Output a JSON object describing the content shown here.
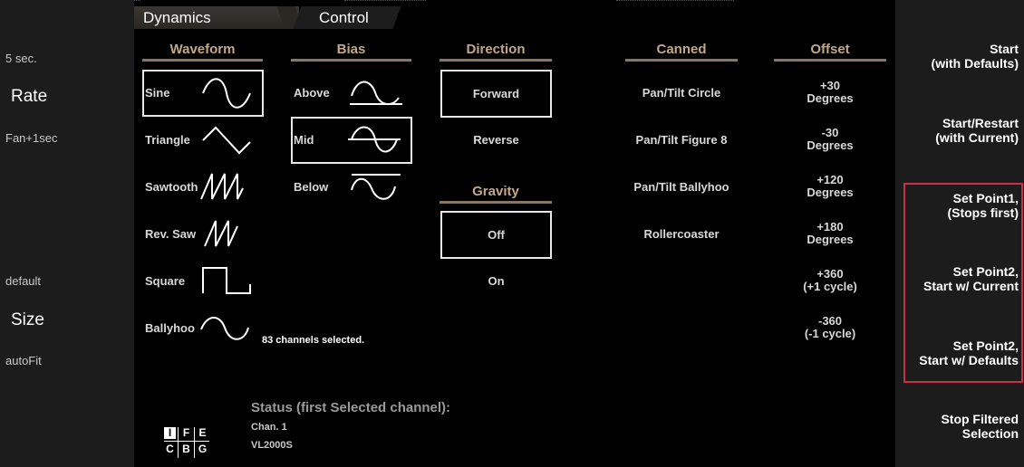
{
  "left": {
    "fade_time": "5 sec.",
    "rate_label": "Rate",
    "rate_value": "Fan+1sec",
    "size_value": "default",
    "size_label": "Size",
    "size_mode": "autoFit"
  },
  "tabs": {
    "dynamics": "Dynamics",
    "control": "Control"
  },
  "waveform": {
    "header": "Waveform",
    "items": [
      "Sine",
      "Triangle",
      "Sawtooth",
      "Rev. Saw",
      "Square",
      "Ballyhoo"
    ]
  },
  "bias": {
    "header": "Bias",
    "items": [
      "Above",
      "Mid",
      "Below"
    ]
  },
  "direction": {
    "header": "Direction",
    "items": [
      "Forward",
      "Reverse"
    ]
  },
  "gravity": {
    "header": "Gravity",
    "items": [
      "Off",
      "On"
    ]
  },
  "canned": {
    "header": "Canned",
    "items": [
      "Pan/Tilt Circle",
      "Pan/Tilt Figure 8",
      "Pan/Tilt Ballyhoo",
      "Rollercoaster"
    ]
  },
  "offset": {
    "header": "Offset",
    "items": [
      {
        "l1": "+30",
        "l2": "Degrees"
      },
      {
        "l1": "-30",
        "l2": "Degrees"
      },
      {
        "l1": "+120",
        "l2": "Degrees"
      },
      {
        "l1": "+180",
        "l2": "Degrees"
      },
      {
        "l1": "+360",
        "l2": "(+1 cycle)"
      },
      {
        "l1": "-360",
        "l2": "(-1 cycle)"
      }
    ]
  },
  "selection": "83 channels selected.",
  "status": {
    "title": "Status (first Selected channel):",
    "chan": "Chan. 1",
    "fixture": "VL2000S"
  },
  "ifecbg": [
    "I",
    "F",
    "E",
    "C",
    "B",
    "G"
  ],
  "right": {
    "start_l1": "Start",
    "start_l2": "(with Defaults)",
    "restart_l1": "Start/Restart",
    "restart_l2": "(with Current)",
    "p1_l1": "Set Point1,",
    "p1_l2": "(Stops first)",
    "p2c_l1": "Set Point2,",
    "p2c_l2": "Start w/ Current",
    "p2d_l1": "Set Point2,",
    "p2d_l2": "Start w/ Defaults",
    "stop_l1": "Stop Filtered",
    "stop_l2": "Selection"
  },
  "colors": {
    "header_accent": "#c4a789",
    "highlight_border": "#c8304a"
  }
}
